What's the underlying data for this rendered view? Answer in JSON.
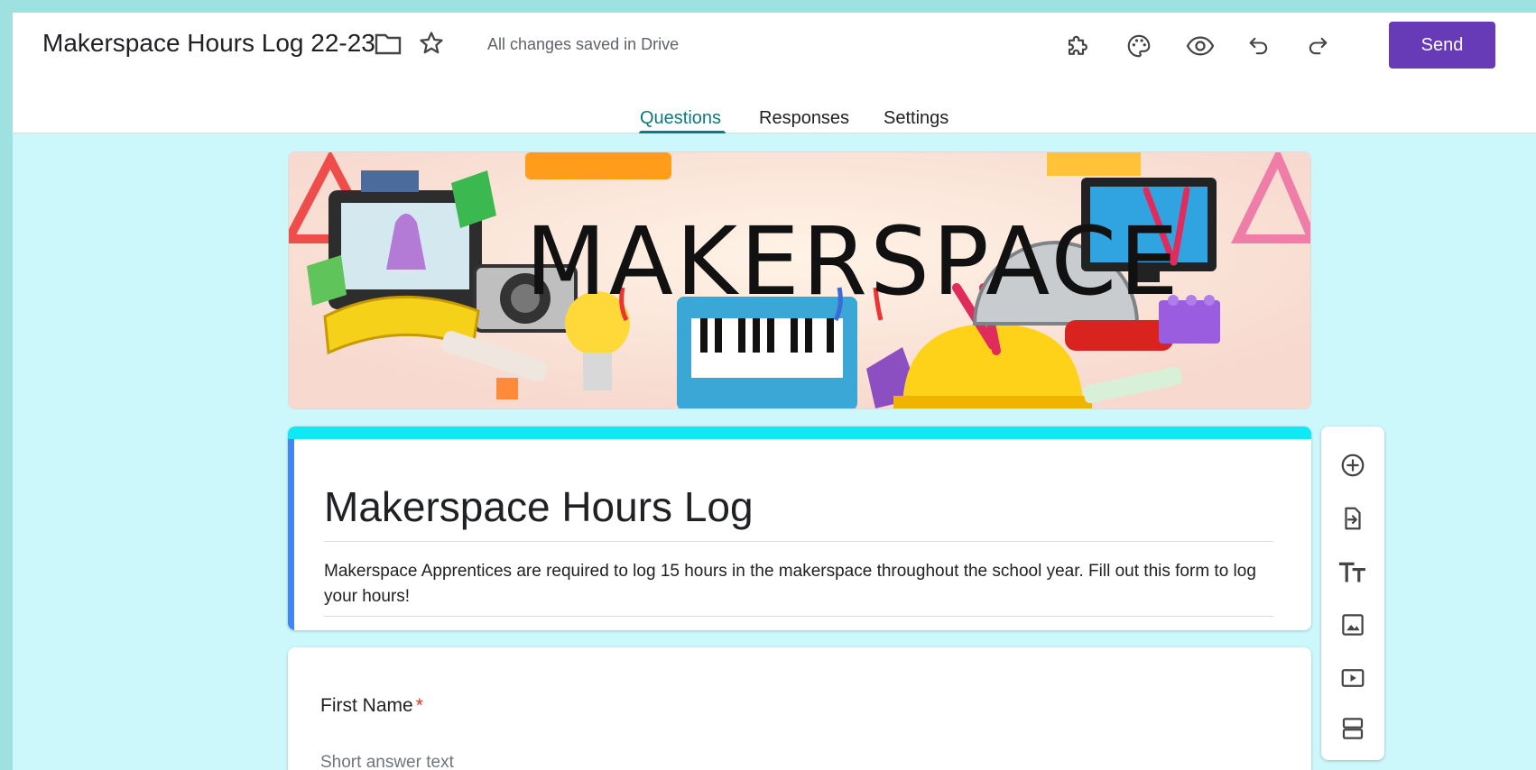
{
  "header": {
    "doc_title": "Makerspace Hours Log 22-23",
    "save_status": "All changes saved in Drive",
    "send_label": "Send",
    "icons": [
      "folder-icon",
      "star-icon",
      "addon-puzzle-icon",
      "palette-icon",
      "preview-eye-icon",
      "undo-icon",
      "redo-icon"
    ]
  },
  "tabs": [
    {
      "label": "Questions",
      "active": true
    },
    {
      "label": "Responses",
      "active": false
    },
    {
      "label": "Settings",
      "active": false
    }
  ],
  "banner": {
    "text": "MAKERSPACE"
  },
  "form": {
    "title": "Makerspace Hours Log",
    "description": "Makerspace Apprentices are required to log 15 hours in the makerspace throughout the school year. Fill out this form to log your hours!"
  },
  "question": {
    "title": "First Name",
    "required_mark": "*",
    "placeholder": "Short answer text"
  },
  "side_toolbar": {
    "icons": [
      "add-question-icon",
      "import-questions-icon",
      "add-title-icon",
      "add-image-icon",
      "add-video-icon",
      "add-section-icon"
    ]
  },
  "colors": {
    "accent": "#673ab7",
    "tab_active": "#0b7a81",
    "header_strip": "#11e8f5",
    "left_strip": "#4285f4",
    "page_background": "#ccf7fb"
  }
}
